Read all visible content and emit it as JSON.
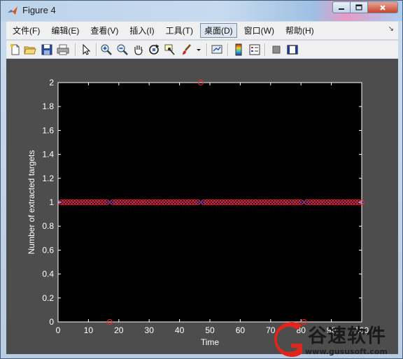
{
  "window": {
    "title": "Figure 4",
    "controls": [
      "minimize",
      "maximize",
      "close"
    ]
  },
  "menu": {
    "items": [
      "文件(F)",
      "编辑(E)",
      "查看(V)",
      "插入(I)",
      "工具(T)",
      "桌面(D)",
      "窗口(W)",
      "帮助(H)"
    ],
    "active": "桌面(D)"
  },
  "toolbar": {
    "icons": [
      "new-figure-icon",
      "open-file-icon",
      "save-icon",
      "print-icon",
      "select-arrow-icon",
      "zoom-in-icon",
      "zoom-out-icon",
      "pan-hand-icon",
      "rotate-3d-icon",
      "data-cursor-icon",
      "brush-icon",
      "dropdown-arrow-icon",
      "link-plot-icon",
      "colorbar-icon",
      "legend-icon",
      "hide-plot-tools-icon",
      "show-plot-tools-icon"
    ]
  },
  "chart_data": {
    "type": "scatter",
    "xlabel": "Time",
    "ylabel": "Number of extracted targets",
    "xlim": [
      0,
      100
    ],
    "ylim": [
      0,
      2
    ],
    "xticks": [
      "0",
      "10",
      "20",
      "30",
      "40",
      "50",
      "60",
      "70",
      "80",
      "90",
      "100"
    ],
    "yticks": [
      "0",
      "0.2",
      "0.4",
      "0.6",
      "0.8",
      "1",
      "1.2",
      "1.4",
      "1.6",
      "1.8",
      "2"
    ],
    "background": "#000000",
    "figure_background": "#4d4d4d",
    "axis_color": "#ffffff",
    "grid": false,
    "series": [
      {
        "marker": "x",
        "color": "#4040ff",
        "x": [
          1,
          2,
          3,
          4,
          5,
          6,
          7,
          8,
          9,
          10,
          11,
          12,
          13,
          14,
          15,
          16,
          17,
          18,
          19,
          20,
          21,
          22,
          23,
          24,
          25,
          26,
          27,
          28,
          29,
          30,
          31,
          32,
          33,
          34,
          35,
          36,
          37,
          38,
          39,
          40,
          41,
          42,
          43,
          44,
          45,
          46,
          47,
          48,
          49,
          50,
          51,
          52,
          53,
          54,
          55,
          56,
          57,
          58,
          59,
          60,
          61,
          62,
          63,
          64,
          65,
          66,
          67,
          68,
          69,
          70,
          71,
          72,
          73,
          74,
          75,
          76,
          77,
          78,
          79,
          80,
          81,
          82,
          83,
          84,
          85,
          86,
          87,
          88,
          89,
          90,
          91,
          92,
          93,
          94,
          95,
          96,
          97,
          98,
          99,
          100
        ],
        "y_constant": 1
      },
      {
        "marker": "o",
        "color": "#ff2020",
        "x": [
          1,
          2,
          3,
          4,
          5,
          6,
          7,
          8,
          9,
          10,
          11,
          12,
          13,
          14,
          15,
          16,
          17,
          18,
          19,
          20,
          21,
          22,
          23,
          24,
          25,
          26,
          27,
          28,
          29,
          30,
          31,
          32,
          33,
          34,
          35,
          36,
          37,
          38,
          39,
          40,
          41,
          42,
          43,
          44,
          45,
          46,
          47,
          48,
          49,
          50,
          51,
          52,
          53,
          54,
          55,
          56,
          57,
          58,
          59,
          60,
          61,
          62,
          63,
          64,
          65,
          66,
          67,
          68,
          69,
          70,
          71,
          72,
          73,
          74,
          75,
          76,
          77,
          78,
          79,
          80,
          81,
          82,
          83,
          84,
          85,
          86,
          87,
          88,
          89,
          90,
          91,
          92,
          93,
          94,
          95,
          96,
          97,
          98,
          99,
          100
        ],
        "y_constant": 1,
        "exceptions": [
          {
            "x": 17,
            "y": 0
          },
          {
            "x": 47,
            "y": 2
          },
          {
            "x": 81,
            "y": 0
          }
        ]
      }
    ]
  },
  "watermark": {
    "text": "谷速软件",
    "url": "www.gususoft.com",
    "color": "#e0261b"
  }
}
